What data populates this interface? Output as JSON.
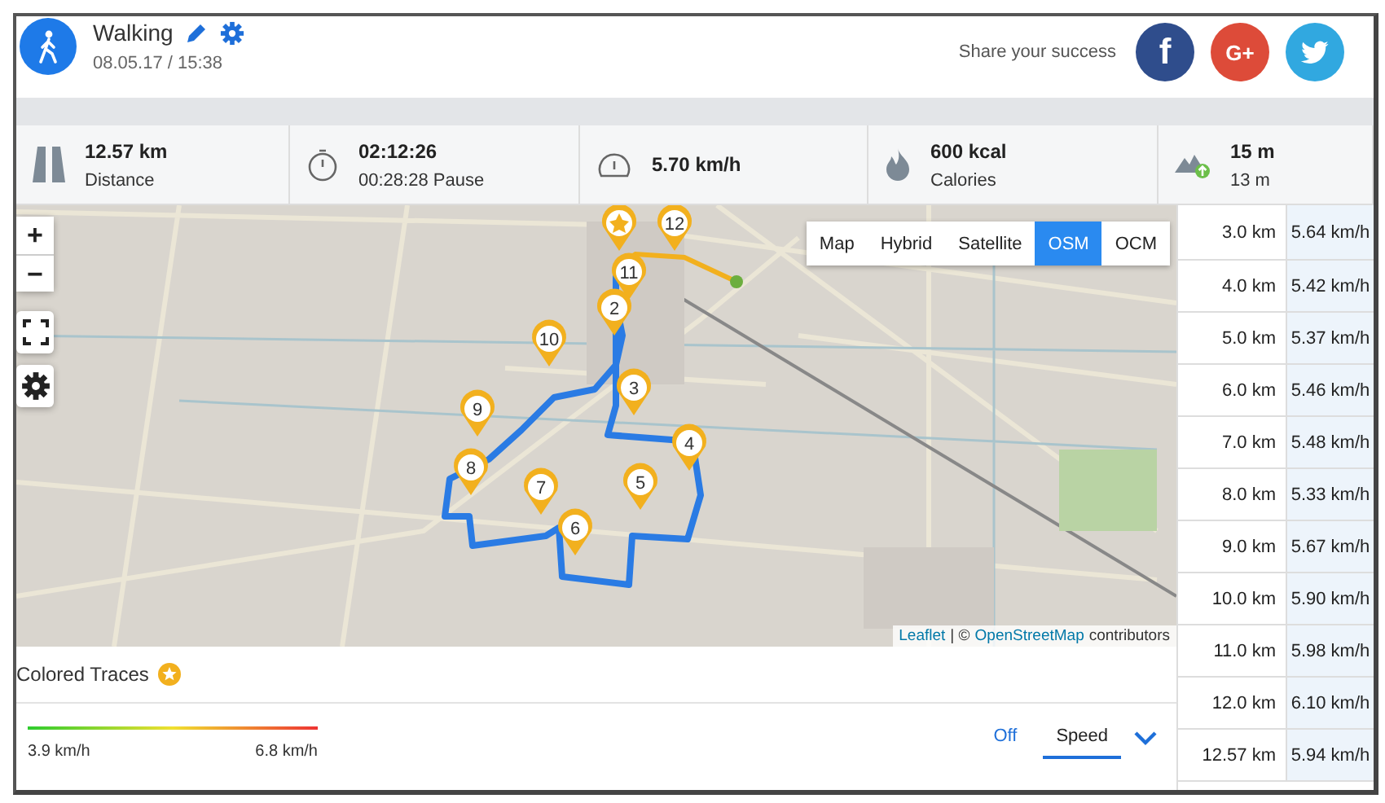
{
  "activity": {
    "title": "Walking",
    "date": "08.05.17 / 15:38"
  },
  "share": {
    "label": "Share your success",
    "buttons": [
      {
        "kind": "facebook",
        "glyph": "f"
      },
      {
        "kind": "google",
        "glyph": "G+"
      },
      {
        "kind": "twitter"
      }
    ]
  },
  "stats": [
    {
      "kind": "distance",
      "value": "12.57 km",
      "label": "Distance"
    },
    {
      "kind": "duration",
      "value": "02:12:26",
      "label": "00:28:28 Pause"
    },
    {
      "kind": "speed",
      "value": "5.70 km/h"
    },
    {
      "kind": "calories",
      "value": "600 kcal",
      "label": "Calories"
    },
    {
      "kind": "elevation",
      "value": "15 m",
      "label": "13 m"
    }
  ],
  "map": {
    "zoom_in": "+",
    "zoom_out": "−",
    "layer_buttons": [
      {
        "label": "Map",
        "selected": false
      },
      {
        "label": "Hybrid",
        "selected": false
      },
      {
        "label": "Satellite",
        "selected": false
      },
      {
        "label": "OSM",
        "selected": true
      },
      {
        "label": "OCM",
        "selected": false
      }
    ],
    "markers": [
      {
        "kind": "start"
      },
      {
        "kind": "number",
        "label": "12"
      },
      {
        "kind": "number",
        "label": "11"
      },
      {
        "kind": "number",
        "label": "2"
      },
      {
        "kind": "number",
        "label": "10"
      },
      {
        "kind": "number",
        "label": "3"
      },
      {
        "kind": "number",
        "label": "9"
      },
      {
        "kind": "number",
        "label": "4"
      },
      {
        "kind": "number",
        "label": "8"
      },
      {
        "kind": "number",
        "label": "7"
      },
      {
        "kind": "number",
        "label": "5"
      },
      {
        "kind": "number",
        "label": "6"
      }
    ],
    "attribution": {
      "link1": "Leaflet",
      "separator": "| ©",
      "link2": "OpenStreetMap",
      "suffix": "contributors"
    }
  },
  "splits": [
    {
      "distance": "3.0 km",
      "speed": "5.64 km/h"
    },
    {
      "distance": "4.0 km",
      "speed": "5.42 km/h"
    },
    {
      "distance": "5.0 km",
      "speed": "5.37 km/h"
    },
    {
      "distance": "6.0 km",
      "speed": "5.46 km/h"
    },
    {
      "distance": "7.0 km",
      "speed": "5.48 km/h"
    },
    {
      "distance": "8.0 km",
      "speed": "5.33 km/h"
    },
    {
      "distance": "9.0 km",
      "speed": "5.67 km/h"
    },
    {
      "distance": "10.0 km",
      "speed": "5.90 km/h"
    },
    {
      "distance": "11.0 km",
      "speed": "5.98 km/h"
    },
    {
      "distance": "12.0 km",
      "speed": "6.10 km/h"
    },
    {
      "distance": "12.57 km",
      "speed": "5.94 km/h"
    }
  ],
  "colored_traces": {
    "title": "Colored Traces",
    "min": "3.9 km/h",
    "max": "6.8 km/h",
    "modes": [
      {
        "label": "Off",
        "selected": false
      },
      {
        "label": "Speed",
        "selected": true
      }
    ]
  }
}
